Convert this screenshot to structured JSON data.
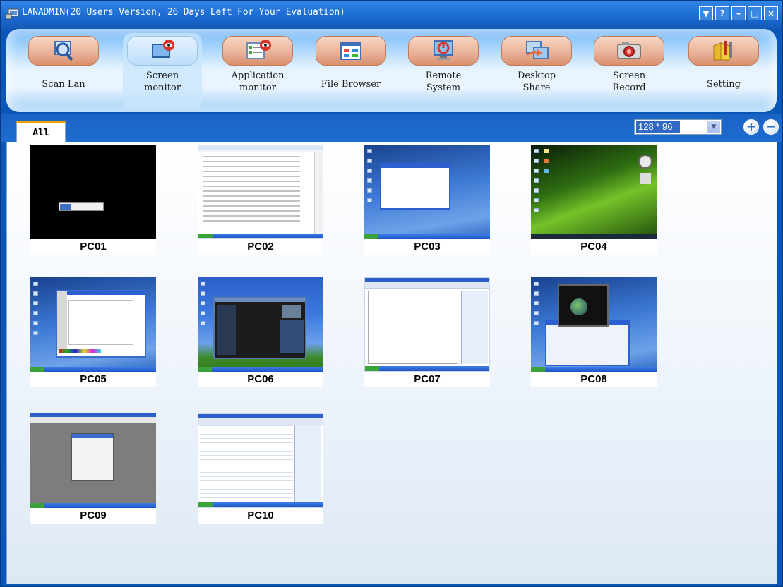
{
  "window": {
    "title": "LANADMIN(20 Users Version, 26 Days Left For Your Evaluation)",
    "controls": [
      "▼",
      "?",
      "–",
      "□",
      "×"
    ]
  },
  "toolbar": {
    "items": [
      {
        "label_line1": "Scan Lan",
        "label_line2": "",
        "icon": "scan-lan-icon"
      },
      {
        "label_line1": "Screen",
        "label_line2": "monitor",
        "icon": "screen-monitor-icon"
      },
      {
        "label_line1": "Application",
        "label_line2": "monitor",
        "icon": "application-monitor-icon"
      },
      {
        "label_line1": "File Browser",
        "label_line2": "",
        "icon": "file-browser-icon"
      },
      {
        "label_line1": "Remote",
        "label_line2": "System",
        "icon": "remote-system-icon"
      },
      {
        "label_line1": "Desktop",
        "label_line2": "Share",
        "icon": "desktop-share-icon"
      },
      {
        "label_line1": "Screen",
        "label_line2": "Record",
        "icon": "screen-record-icon"
      },
      {
        "label_line1": "Setting",
        "label_line2": "",
        "icon": "setting-icon"
      }
    ]
  },
  "tabs": {
    "active": "All"
  },
  "thumbnail_size": {
    "selected": "128 * 96"
  },
  "zoom": {
    "plus": "+",
    "minus": "−"
  },
  "computers": [
    {
      "name": "PC01",
      "screen": "black"
    },
    {
      "name": "PC02",
      "screen": "doc"
    },
    {
      "name": "PC03",
      "screen": "blue"
    },
    {
      "name": "PC04",
      "screen": "vista"
    },
    {
      "name": "PC05",
      "screen": "blue"
    },
    {
      "name": "PC06",
      "screen": "xp"
    },
    {
      "name": "PC07",
      "screen": "doc"
    },
    {
      "name": "PC08",
      "screen": "blue"
    },
    {
      "name": "PC09",
      "screen": "grey"
    },
    {
      "name": "PC10",
      "screen": "doc"
    }
  ]
}
